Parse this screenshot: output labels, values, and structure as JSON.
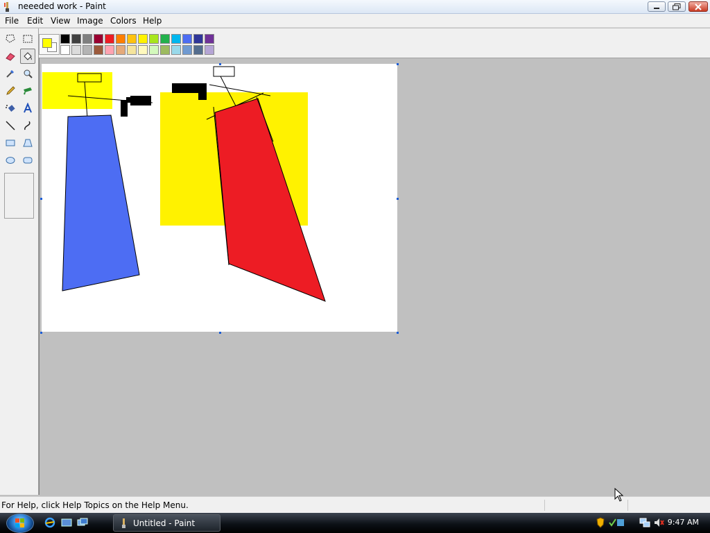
{
  "window": {
    "title": "neeeded work - Paint",
    "controls": {
      "minimize": "minimize-icon",
      "maximize": "restore-icon",
      "close": "close-icon"
    }
  },
  "menu": [
    "File",
    "Edit",
    "View",
    "Image",
    "Colors",
    "Help"
  ],
  "tools": [
    "free-form-select-icon",
    "select-icon",
    "eraser-icon",
    "fill-bucket-icon",
    "color-picker-icon",
    "magnifier-icon",
    "pencil-icon",
    "brush-icon",
    "airbrush-icon",
    "text-icon",
    "line-icon",
    "curve-icon",
    "rectangle-icon",
    "polygon-icon",
    "ellipse-icon",
    "rounded-rectangle-icon"
  ],
  "selected_tool": "fill-bucket-icon",
  "colors": {
    "foreground": "#ffff00",
    "background": "#ffffff",
    "palette_top": [
      "#000000",
      "#404040",
      "#7f7f7f",
      "#990030",
      "#ed1c24",
      "#ff7e00",
      "#ffc20e",
      "#fff200",
      "#a8e61d",
      "#22b14c",
      "#00b7ef",
      "#4d6df3",
      "#2f3699",
      "#6f3198"
    ],
    "palette_bottom": [
      "#ffffff",
      "#dcdcdc",
      "#b4b4b4",
      "#9c5a3c",
      "#ffa3b1",
      "#e5aa7a",
      "#f5e49c",
      "#fff9bd",
      "#d3f9bc",
      "#9dbb61",
      "#99d9ea",
      "#709ad1",
      "#546d8e",
      "#b5a5d5"
    ]
  },
  "status": {
    "help_text": "For Help, click Help Topics on the Help Menu."
  },
  "taskbar": {
    "start": "windows-start-icon",
    "quick_launch": [
      "internet-explorer-icon",
      "show-desktop-icon",
      "switch-windows-icon"
    ],
    "task_label": "Untitled - Paint",
    "tray_icons": [
      "shield-icon",
      "network-icon",
      "speaker-muted-icon"
    ],
    "clock": "9:47 AM"
  }
}
